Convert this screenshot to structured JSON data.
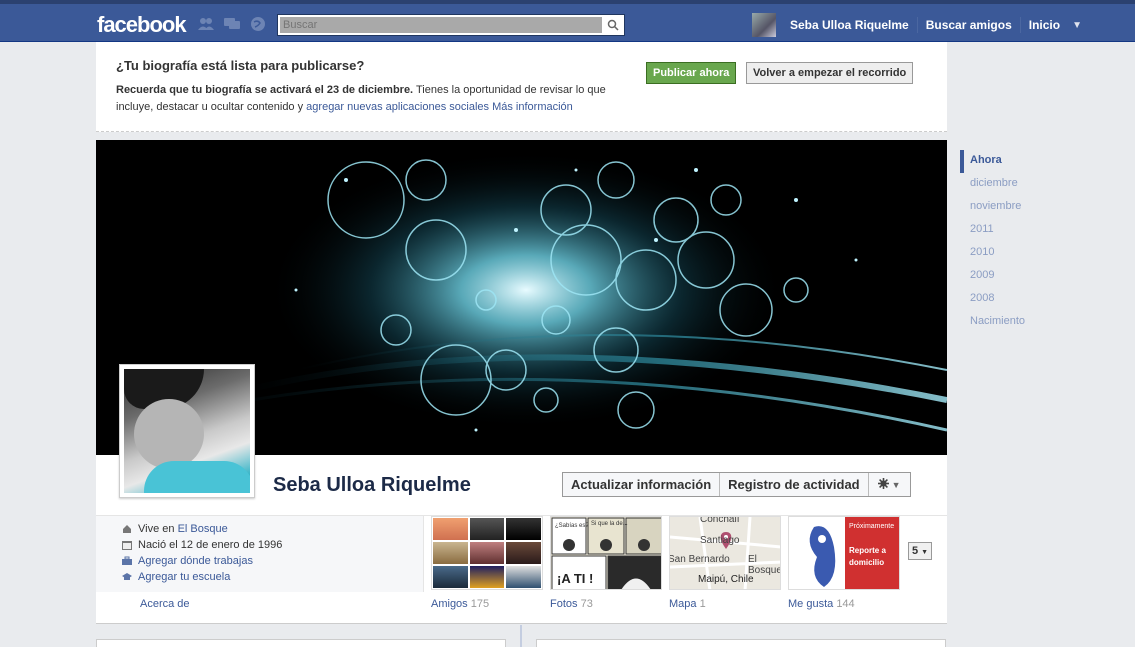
{
  "header": {
    "logo": "facebook",
    "search_placeholder": "Buscar",
    "user_name": "Seba Ulloa Riquelme",
    "find_friends": "Buscar amigos",
    "home": "Inicio"
  },
  "banner": {
    "title": "¿Tu biografía está lista para publicarse?",
    "text_bold": "Recuerda que tu biografía se activará el 23 de diciembre.",
    "text_rest": " Tienes la oportunidad de revisar lo que incluye, destacar u ocultar contenido y ",
    "link_apps": "agregar nuevas aplicaciones sociales",
    "link_more": "Más información",
    "publish_button": "Publicar ahora",
    "restart_button": "Volver a empezar el recorrido"
  },
  "timeline_nav": [
    "Ahora",
    "diciembre",
    "noviembre",
    "2011",
    "2010",
    "2009",
    "2008",
    "Nacimiento"
  ],
  "profile": {
    "name": "Seba Ulloa Riquelme",
    "update_info": "Actualizar información",
    "activity_log": "Registro de actividad"
  },
  "about": {
    "lives_prefix": "Vive en ",
    "lives_place": "El Bosque",
    "born": "Nació el 12 de enero de 1996",
    "add_work": "Agregar dónde trabajas",
    "add_school": "Agregar tu escuela",
    "link": "Acerca de"
  },
  "tiles": {
    "friends": {
      "label": "Amigos",
      "count": "175"
    },
    "photos": {
      "label": "Fotos",
      "count": "73",
      "comic_text": "¡A TI !",
      "bubble_1": "¿Sabías es?",
      "bubble_2": "Si que la de..."
    },
    "map": {
      "label": "Mapa",
      "count": "1",
      "places": [
        "Conchalí",
        "Santiago",
        "San Bernardo",
        "El Bosque",
        "Maipú, Chile"
      ]
    },
    "likes": {
      "label": "Me gusta",
      "count": "144",
      "card_text": [
        "Próximamente",
        "Reporte a domicilio"
      ]
    },
    "more": "5"
  }
}
